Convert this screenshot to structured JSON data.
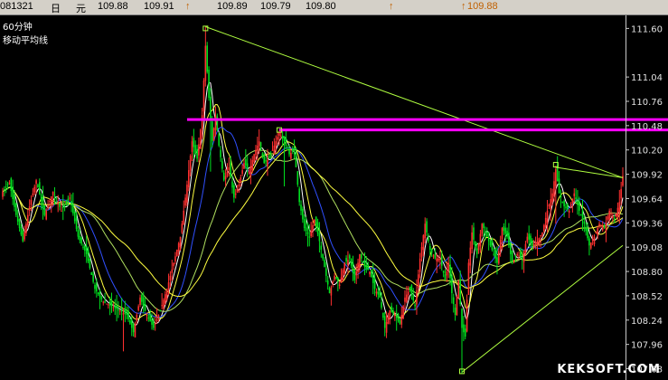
{
  "header": {
    "code": "081321",
    "period_char": "日",
    "unit_char": "元",
    "v1": "109.88",
    "v2": "109.91",
    "v3": "109.89",
    "v4": "109.79",
    "v5": "109.80",
    "current": "109.88",
    "arrow": "↑",
    "arrow2": "↑"
  },
  "labels": {
    "interval": "60分钟",
    "indicator": "移动平均线"
  },
  "watermark": "KEKSOFT.COM",
  "colors": {
    "up": "#ff3030",
    "down": "#00e020",
    "ma_short": "#ffffff",
    "ma_mid": "#ffff40",
    "ma_blue": "#3050ff",
    "ma_long": "#b0e060",
    "trendline": "#b0ff40",
    "hline": "#ff00ff",
    "axis": "#c8c8c8"
  },
  "chart_data": {
    "type": "line",
    "x_type": "hourly bars",
    "ylim": [
      107.55,
      111.75
    ],
    "yticks": [
      "111.60",
      "111.04",
      "110.76",
      "110.48",
      "110.20",
      "109.92",
      "109.64",
      "109.36",
      "109.08",
      "108.80",
      "108.52",
      "108.24",
      "107.96",
      "107.68"
    ],
    "anchors": [
      [
        0,
        109.72
      ],
      [
        4,
        109.82
      ],
      [
        8,
        109.45
      ],
      [
        12,
        109.15
      ],
      [
        16,
        109.55
      ],
      [
        20,
        109.85
      ],
      [
        25,
        109.45
      ],
      [
        30,
        109.72
      ],
      [
        35,
        109.5
      ],
      [
        40,
        109.65
      ],
      [
        45,
        109.2
      ],
      [
        50,
        109.0
      ],
      [
        55,
        108.6
      ],
      [
        60,
        108.45
      ],
      [
        65,
        108.4
      ],
      [
        70,
        108.35
      ],
      [
        74,
        108.3
      ],
      [
        78,
        108.1
      ],
      [
        82,
        108.5
      ],
      [
        86,
        108.3
      ],
      [
        90,
        108.15
      ],
      [
        94,
        108.35
      ],
      [
        98,
        108.6
      ],
      [
        102,
        108.9
      ],
      [
        106,
        109.2
      ],
      [
        110,
        109.8
      ],
      [
        113,
        110.3
      ],
      [
        116,
        110.1
      ],
      [
        119,
        110.6
      ],
      [
        121,
        111.4
      ],
      [
        123,
        110.8
      ],
      [
        125,
        110.3
      ],
      [
        127,
        110.6
      ],
      [
        129,
        110.25
      ],
      [
        132,
        109.85
      ],
      [
        135,
        110.0
      ],
      [
        138,
        109.65
      ],
      [
        141,
        109.8
      ],
      [
        144,
        110.05
      ],
      [
        147,
        109.95
      ],
      [
        150,
        110.15
      ],
      [
        153,
        110.3
      ],
      [
        156,
        110.05
      ],
      [
        159,
        110.1
      ],
      [
        162,
        110.25
      ],
      [
        165,
        110.4
      ],
      [
        168,
        110.3
      ],
      [
        171,
        110.15
      ],
      [
        174,
        110.2
      ],
      [
        177,
        109.6
      ],
      [
        180,
        109.3
      ],
      [
        183,
        109.2
      ],
      [
        186,
        109.4
      ],
      [
        189,
        109.15
      ],
      [
        192,
        108.85
      ],
      [
        195,
        108.55
      ],
      [
        198,
        108.75
      ],
      [
        201,
        108.65
      ],
      [
        204,
        108.9
      ],
      [
        207,
        108.95
      ],
      [
        210,
        108.7
      ],
      [
        213,
        109.0
      ],
      [
        216,
        108.85
      ],
      [
        219,
        108.8
      ],
      [
        222,
        108.6
      ],
      [
        225,
        108.5
      ],
      [
        228,
        108.15
      ],
      [
        231,
        108.35
      ],
      [
        234,
        108.3
      ],
      [
        237,
        108.2
      ],
      [
        240,
        108.5
      ],
      [
        243,
        108.6
      ],
      [
        246,
        108.4
      ],
      [
        249,
        108.95
      ],
      [
        252,
        109.35
      ],
      [
        255,
        109.05
      ],
      [
        258,
        108.95
      ],
      [
        261,
        108.95
      ],
      [
        264,
        108.7
      ],
      [
        266,
        108.9
      ],
      [
        268,
        108.55
      ],
      [
        270,
        108.3
      ],
      [
        272,
        108.7
      ],
      [
        274,
        108.15
      ],
      [
        276,
        108.05
      ],
      [
        278,
        108.9
      ],
      [
        280,
        109.25
      ],
      [
        283,
        109.0
      ],
      [
        286,
        109.35
      ],
      [
        289,
        109.2
      ],
      [
        292,
        109.05
      ],
      [
        295,
        108.9
      ],
      [
        298,
        109.3
      ],
      [
        301,
        109.2
      ],
      [
        304,
        108.9
      ],
      [
        307,
        109.0
      ],
      [
        310,
        108.95
      ],
      [
        313,
        109.2
      ],
      [
        316,
        109.1
      ],
      [
        319,
        109.15
      ],
      [
        322,
        109.25
      ],
      [
        325,
        109.5
      ],
      [
        328,
        109.7
      ],
      [
        330,
        109.98
      ],
      [
        332,
        109.7
      ],
      [
        335,
        109.55
      ],
      [
        338,
        109.5
      ],
      [
        341,
        109.7
      ],
      [
        344,
        109.5
      ],
      [
        347,
        109.35
      ],
      [
        350,
        109.1
      ],
      [
        353,
        109.2
      ],
      [
        356,
        109.35
      ],
      [
        359,
        109.3
      ],
      [
        362,
        109.5
      ],
      [
        365,
        109.4
      ],
      [
        368,
        109.6
      ],
      [
        370,
        109.9
      ]
    ],
    "lows": [
      [
        72,
        107.88
      ],
      [
        124,
        109.95
      ],
      [
        168,
        109.78
      ],
      [
        274,
        107.62
      ],
      [
        330,
        109.35
      ]
    ],
    "highs": [
      [
        121,
        111.62
      ],
      [
        174,
        110.32
      ],
      [
        330,
        110.02
      ],
      [
        370,
        110.0
      ]
    ],
    "ma_periods": [
      5,
      10,
      20,
      40,
      60
    ],
    "trendlines": [
      {
        "x1": 121,
        "y1": 111.62,
        "x2": 370,
        "y2": 109.88
      },
      {
        "x1": 274,
        "y1": 107.64,
        "x2": 370,
        "y2": 109.1
      },
      {
        "x1": 330,
        "y1": 110.0,
        "x2": 370,
        "y2": 109.88
      }
    ],
    "hlines": [
      {
        "x_start": 110,
        "y": 110.55
      },
      {
        "x_start": 165,
        "y": 110.43
      }
    ],
    "markers": [
      {
        "x": 121,
        "y": 111.6
      },
      {
        "x": 165,
        "y": 110.43
      },
      {
        "x": 330,
        "y": 110.03
      },
      {
        "x": 274,
        "y": 107.65
      }
    ]
  }
}
